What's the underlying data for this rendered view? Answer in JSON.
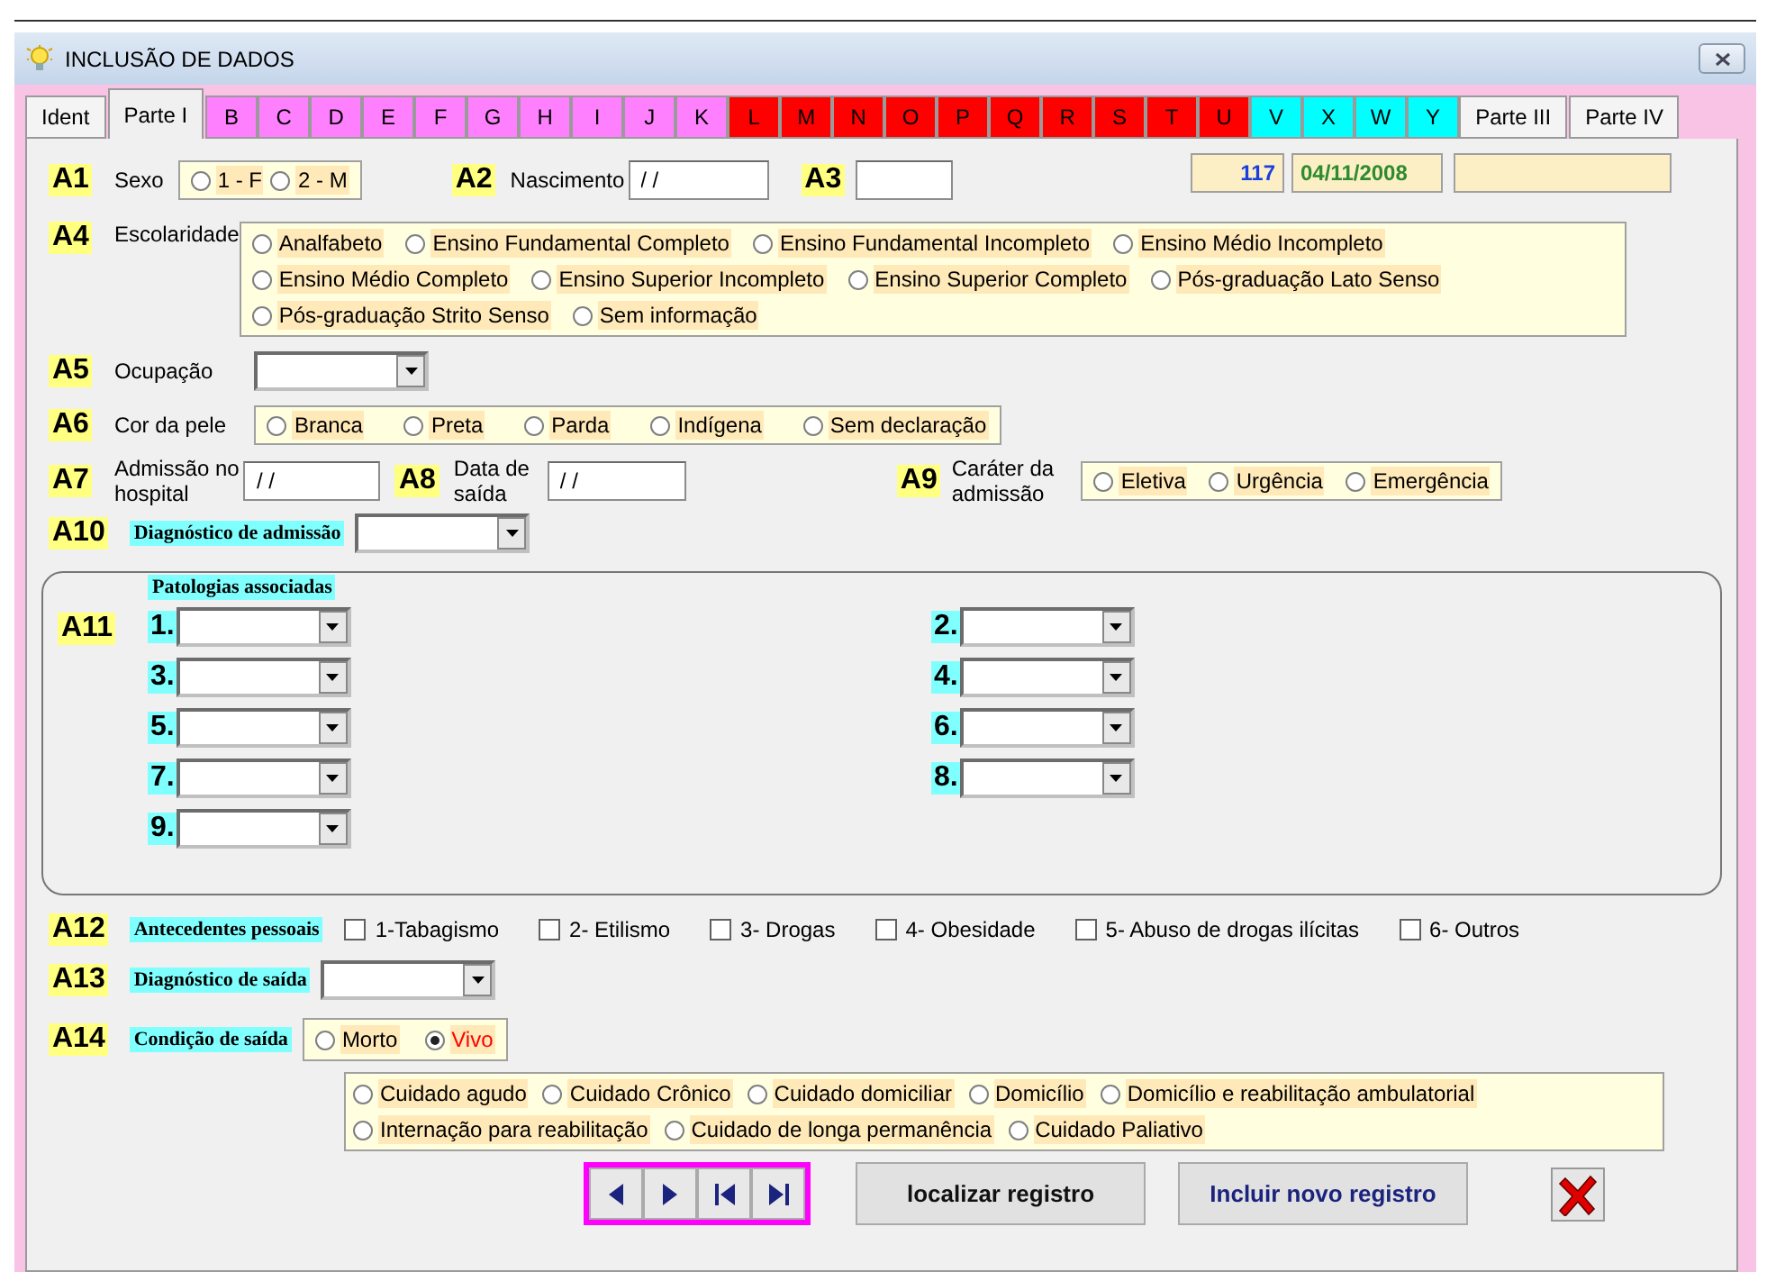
{
  "window": {
    "title": "INCLUSÃO DE DADOS"
  },
  "tabs": [
    {
      "label": "Ident",
      "selected": false
    },
    {
      "label": "Parte I",
      "selected": true
    },
    {
      "label": "B",
      "selected": false,
      "color": "#ff80ff"
    },
    {
      "label": "C",
      "selected": false,
      "color": "#ff80ff"
    },
    {
      "label": "D",
      "selected": false,
      "color": "#ff80ff"
    },
    {
      "label": "E",
      "selected": false,
      "color": "#ff80ff"
    },
    {
      "label": "F",
      "selected": false,
      "color": "#ff80ff"
    },
    {
      "label": "G",
      "selected": false,
      "color": "#ff80ff"
    },
    {
      "label": "H",
      "selected": false,
      "color": "#ff80ff"
    },
    {
      "label": "I",
      "selected": false,
      "color": "#ff80ff"
    },
    {
      "label": "J",
      "selected": false,
      "color": "#ff80ff"
    },
    {
      "label": "K",
      "selected": false,
      "color": "#ff80ff"
    },
    {
      "label": "L",
      "selected": false,
      "color": "#ff0000"
    },
    {
      "label": "M",
      "selected": false,
      "color": "#ff0000"
    },
    {
      "label": "N",
      "selected": false,
      "color": "#ff0000"
    },
    {
      "label": "O",
      "selected": false,
      "color": "#ff0000"
    },
    {
      "label": "P",
      "selected": false,
      "color": "#ff0000"
    },
    {
      "label": "Q",
      "selected": false,
      "color": "#ff0000"
    },
    {
      "label": "R",
      "selected": false,
      "color": "#ff0000"
    },
    {
      "label": "S",
      "selected": false,
      "color": "#ff0000"
    },
    {
      "label": "T",
      "selected": false,
      "color": "#ff0000"
    },
    {
      "label": "U",
      "selected": false,
      "color": "#ff0000"
    },
    {
      "label": "V",
      "selected": false,
      "color": "#00ffff"
    },
    {
      "label": "X",
      "selected": false,
      "color": "#00ffff"
    },
    {
      "label": "W",
      "selected": false,
      "color": "#00ffff"
    },
    {
      "label": "Y",
      "selected": false,
      "color": "#00ffff"
    },
    {
      "label": "Parte III",
      "selected": false
    },
    {
      "label": "Parte IV",
      "selected": false
    }
  ],
  "record": {
    "number": "117",
    "date": "04/11/2008"
  },
  "sexo": {
    "code": "A1",
    "label": "Sexo",
    "options": [
      {
        "label": "1 - F",
        "selected": false
      },
      {
        "label": "2 - M",
        "selected": false
      }
    ]
  },
  "nascimento": {
    "code": "A2",
    "label": "Nascimento",
    "value": "/ /"
  },
  "a3": {
    "code": "A3"
  },
  "escolaridade": {
    "code": "A4",
    "label": "Escolaridade",
    "options": [
      {
        "label": "Analfabeto",
        "selected": false
      },
      {
        "label": "Ensino Fundamental Completo",
        "selected": false
      },
      {
        "label": "Ensino Fundamental Incompleto",
        "selected": false
      },
      {
        "label": "Ensino Médio Incompleto",
        "selected": false
      },
      {
        "label": "Ensino Médio Completo",
        "selected": false
      },
      {
        "label": "Ensino Superior Incompleto",
        "selected": false
      },
      {
        "label": "Ensino Superior Completo",
        "selected": false
      },
      {
        "label": "Pós-graduação Lato Senso",
        "selected": false
      },
      {
        "label": "Pós-graduação Strito Senso",
        "selected": false
      },
      {
        "label": "Sem informação",
        "selected": false
      }
    ]
  },
  "ocupacao": {
    "code": "A5",
    "label": "Ocupação"
  },
  "cor_da_pele": {
    "code": "A6",
    "label": "Cor da pele",
    "options": [
      {
        "label": "Branca",
        "selected": false
      },
      {
        "label": "Preta",
        "selected": false
      },
      {
        "label": "Parda",
        "selected": false
      },
      {
        "label": "Indígena",
        "selected": false
      },
      {
        "label": "Sem declaração",
        "selected": false
      }
    ]
  },
  "admissao": {
    "code": "A7",
    "label": "Admissão no hospital",
    "value": "/ /"
  },
  "saida": {
    "code": "A8",
    "label": "Data de saída",
    "value": "/ /"
  },
  "carater": {
    "code": "A9",
    "label": "Caráter da admissão",
    "options": [
      {
        "label": "Eletiva",
        "selected": false
      },
      {
        "label": "Urgência",
        "selected": false
      },
      {
        "label": "Emergência",
        "selected": false
      }
    ]
  },
  "diagnostico_admissao": {
    "code": "A10",
    "label": "Diagnóstico de admissão"
  },
  "patologias": {
    "code": "A11",
    "label": "Patologias associadas",
    "items": [
      "1.",
      "2.",
      "3.",
      "4.",
      "5.",
      "6.",
      "7.",
      "8.",
      "9."
    ]
  },
  "antecedentes": {
    "code": "A12",
    "label": "Antecedentes pessoais",
    "options": [
      {
        "label": "1-Tabagismo",
        "checked": false
      },
      {
        "label": "2- Etilismo",
        "checked": false
      },
      {
        "label": "3- Drogas",
        "checked": false
      },
      {
        "label": "4- Obesidade",
        "checked": false
      },
      {
        "label": "5- Abuso de drogas ilícitas",
        "checked": false
      },
      {
        "label": "6- Outros",
        "checked": false
      }
    ]
  },
  "diagnostico_saida": {
    "code": "A13",
    "label": "Diagnóstico de saída"
  },
  "condicao": {
    "code": "A14",
    "label": "Condição de saída",
    "options": [
      {
        "label": "Morto",
        "selected": false
      },
      {
        "label": "Vivo",
        "selected": true
      }
    ]
  },
  "destino": {
    "options": [
      {
        "label": "Cuidado agudo",
        "selected": false
      },
      {
        "label": "Cuidado Crônico",
        "selected": false
      },
      {
        "label": "Cuidado domiciliar",
        "selected": false
      },
      {
        "label": "Domicílio",
        "selected": false
      },
      {
        "label": "Domicílio e reabilitação ambulatorial",
        "selected": false
      },
      {
        "label": "Internação para reabilitação",
        "selected": false
      },
      {
        "label": "Cuidado de longa permanência",
        "selected": false
      },
      {
        "label": "Cuidado Paliativo",
        "selected": false
      }
    ]
  },
  "buttons": [
    {
      "label": "localizar registro",
      "kind": "plain"
    },
    {
      "label": "Incluir novo registro",
      "kind": "primary"
    }
  ]
}
